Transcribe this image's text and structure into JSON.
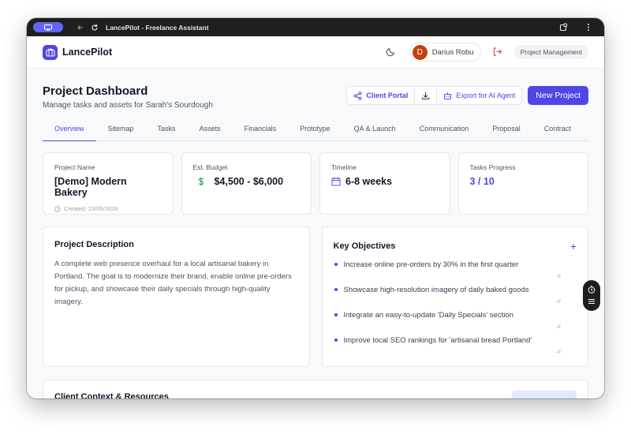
{
  "titlebar": {
    "title": "LancePilot - Freelance Assistant",
    "app_icon": "monitor-icon"
  },
  "header": {
    "logo_text": "LancePilot",
    "user": {
      "initial": "D",
      "name": "Darius Robu"
    },
    "mode_label": "Project Management"
  },
  "page": {
    "title": "Project Dashboard",
    "subtitle": "Manage tasks and assets for Sarah's Sourdough",
    "actions": {
      "client_portal": "Client Portal",
      "export": "Export for AI Agent",
      "new_project": "New Project"
    }
  },
  "tabs": [
    {
      "label": "Overview",
      "active": true
    },
    {
      "label": "Sitemap"
    },
    {
      "label": "Tasks"
    },
    {
      "label": "Assets"
    },
    {
      "label": "Financials"
    },
    {
      "label": "Prototype"
    },
    {
      "label": "QA & Launch"
    },
    {
      "label": "Communication"
    },
    {
      "label": "Proposal"
    },
    {
      "label": "Contract"
    }
  ],
  "cards": {
    "name": {
      "label": "Project Name",
      "value": "[Demo] Modern Bakery",
      "meta": "Created: 23/05/2026"
    },
    "budget": {
      "label": "Est. Budget",
      "value": "$4,500 - $6,000"
    },
    "timeline": {
      "label": "Timeline",
      "value": "6-8 weeks"
    },
    "tasks": {
      "label": "Tasks Progress",
      "value": "3 / 10"
    }
  },
  "description": {
    "title": "Project Description",
    "text": "A complete web presence overhaul for a local artisanal bakery in Portland. The goal is to modernize their brand, enable online pre-orders for pickup, and showcase their daily specials through high-quality imagery."
  },
  "objectives": {
    "title": "Key Objectives",
    "items": [
      "Increase online pre-orders by 30% in the first quarter",
      "Showcase high-resolution imagery of daily baked goods",
      "Integrate an easy-to-update 'Daily Specials' section",
      "Improve local SEO rankings for 'artisanal bread Portland'"
    ]
  },
  "client_context": {
    "title": "Client Context & Resources"
  },
  "colors": {
    "accent": "#4f46e5",
    "danger": "#ef4444",
    "avatar": "#c2410c"
  }
}
